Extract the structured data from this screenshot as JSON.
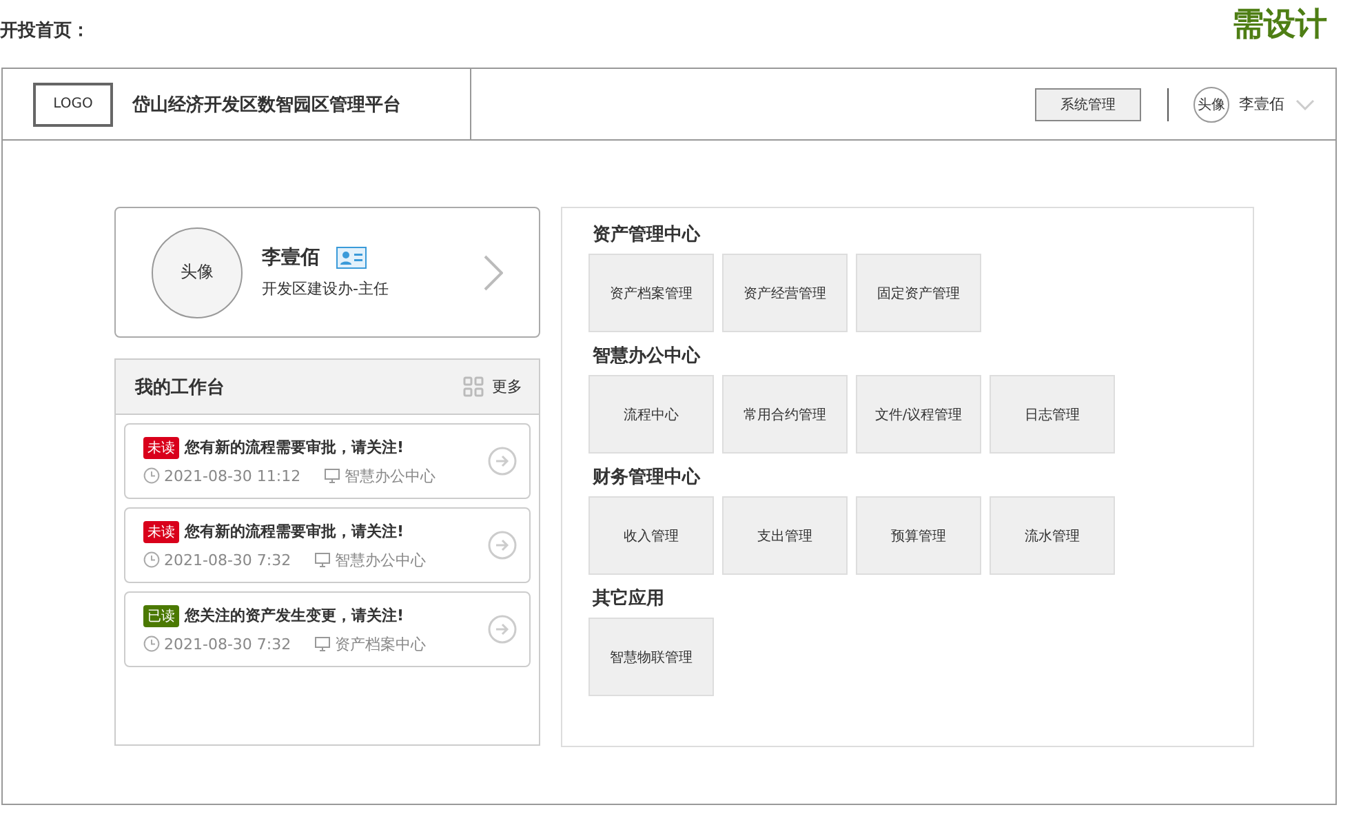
{
  "page_label": "开投首页：",
  "design_note": "需设计",
  "header": {
    "logo": "LOGO",
    "title": "岱山经济开发区数智园区管理平台",
    "system_button": "系统管理",
    "avatar": "头像",
    "user": "李壹佰"
  },
  "profile": {
    "avatar": "头像",
    "name": "李壹佰",
    "role": "开发区建设办-主任"
  },
  "workbench": {
    "title": "我的工作台",
    "more": "更多",
    "messages": [
      {
        "badge": "未读",
        "read": false,
        "text": "您有新的流程需要审批，请关注!",
        "time": "2021-08-30 11:12",
        "source": "智慧办公中心"
      },
      {
        "badge": "未读",
        "read": false,
        "text": "您有新的流程需要审批，请关注!",
        "time": "2021-08-30 7:32",
        "source": "智慧办公中心"
      },
      {
        "badge": "已读",
        "read": true,
        "text": "您关注的资产发生变更，请关注!",
        "time": "2021-08-30 7:32",
        "source": "资产档案中心"
      }
    ]
  },
  "sections": [
    {
      "title": "资产管理中心",
      "apps": [
        "资产档案管理",
        "资产经营管理",
        "固定资产管理"
      ]
    },
    {
      "title": "智慧办公中心",
      "apps": [
        "流程中心",
        "常用合约管理",
        "文件/议程管理",
        "日志管理"
      ]
    },
    {
      "title": "财务管理中心",
      "apps": [
        "收入管理",
        "支出管理",
        "预算管理",
        "流水管理"
      ]
    },
    {
      "title": "其它应用",
      "apps": [
        "智慧物联管理"
      ]
    }
  ]
}
